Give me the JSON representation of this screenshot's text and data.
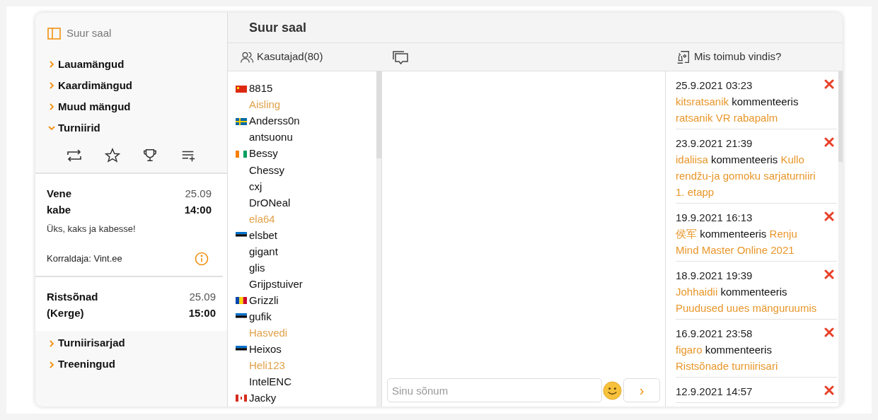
{
  "sidebar": {
    "title": "Suur saal",
    "nav_top": [
      {
        "label": "Lauamängud",
        "expanded": false
      },
      {
        "label": "Kaardimängud",
        "expanded": false
      },
      {
        "label": "Muud mängud",
        "expanded": false
      },
      {
        "label": "Turniirid",
        "expanded": true
      }
    ],
    "tournaments": [
      {
        "name": "Vene kabe",
        "date": "25.09",
        "time": "14:00",
        "description": "Üks, kaks ja kabesse!",
        "organizer": "Korraldaja: Vint.ee"
      },
      {
        "name": "Ristsõnad (Kerge)",
        "date": "25.09",
        "time": "15:00"
      }
    ],
    "nav_bottom": [
      {
        "label": "Turniirisarjad",
        "expanded": false
      },
      {
        "label": "Treeningud",
        "expanded": false
      }
    ]
  },
  "room_title": "Suur saal",
  "users_header": "Kasutajad(80)",
  "feed_header": "Mis toimub vindis?",
  "users": [
    {
      "name": "8815",
      "kind": "cn",
      "guest": false
    },
    {
      "name": "Aisling",
      "kind": "none",
      "guest": true
    },
    {
      "name": "Anderss0n",
      "kind": "se",
      "guest": false
    },
    {
      "name": "antsuonu",
      "kind": "none",
      "guest": false
    },
    {
      "name": "Bessy",
      "kind": "ci",
      "guest": false
    },
    {
      "name": "Chessy",
      "kind": "none",
      "guest": false
    },
    {
      "name": "cxj",
      "kind": "none",
      "guest": false
    },
    {
      "name": "DrONeal",
      "kind": "none",
      "guest": false
    },
    {
      "name": "ela64",
      "kind": "none",
      "guest": true
    },
    {
      "name": "elsbet",
      "kind": "ee",
      "guest": false
    },
    {
      "name": "gigant",
      "kind": "none",
      "guest": false
    },
    {
      "name": "glis",
      "kind": "none",
      "guest": false
    },
    {
      "name": "Grijpstuiver",
      "kind": "none",
      "guest": false
    },
    {
      "name": "Grizzli",
      "kind": "md",
      "guest": false
    },
    {
      "name": "gufik",
      "kind": "ee",
      "guest": false
    },
    {
      "name": "Hasvedi",
      "kind": "none",
      "guest": true
    },
    {
      "name": "Heixos",
      "kind": "ee",
      "guest": false
    },
    {
      "name": "Heli123",
      "kind": "none",
      "guest": true
    },
    {
      "name": "IntelENC",
      "kind": "none",
      "guest": false
    },
    {
      "name": "Jacky",
      "kind": "ca",
      "guest": false
    }
  ],
  "chat": {
    "placeholder": "Sinu sõnum",
    "send": "›"
  },
  "feed": [
    {
      "time": "25.9.2021 03:23",
      "user": "kitsratsanik",
      "verb": "kommenteeris",
      "topic": "ratsanik VR rabapalm"
    },
    {
      "time": "23.9.2021 21:39",
      "user": "idaliisa",
      "verb": "kommenteeris",
      "topic": "Kullo rendžu-ja gomoku sarjaturniiri 1. etapp"
    },
    {
      "time": "19.9.2021 16:13",
      "user": "侯军",
      "verb": "kommenteeris",
      "topic": "Renju Mind Master Online 2021"
    },
    {
      "time": "18.9.2021 19:39",
      "user": "Johhaidii",
      "verb": "kommenteeris",
      "topic": "Puudused uues mänguruumis"
    },
    {
      "time": "16.9.2021 23:58",
      "user": "figaro",
      "verb": "kommenteeris",
      "topic": "Ristsõnade turniirisari"
    },
    {
      "time": "12.9.2021 14:57"
    }
  ]
}
